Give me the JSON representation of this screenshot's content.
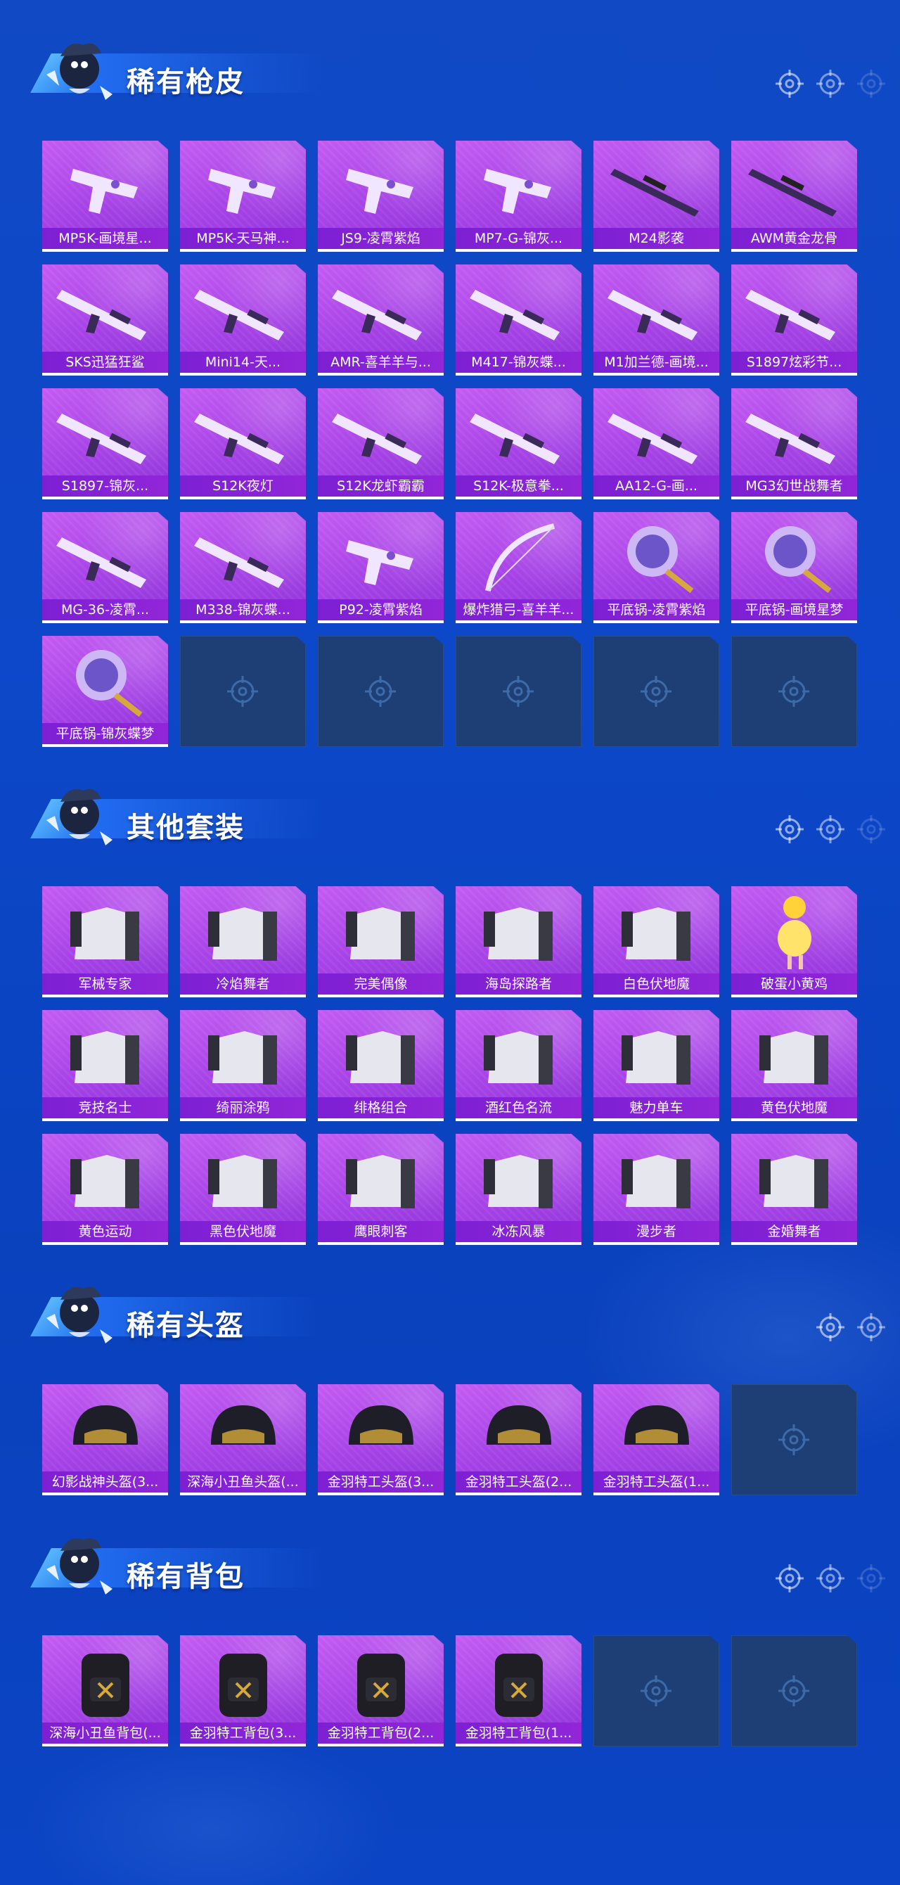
{
  "sections": [
    {
      "title": "稀有枪皮",
      "items": [
        {
          "label": "MP5K-画境星...",
          "icon": "smg-skin-icon"
        },
        {
          "label": "MP5K-天马神...",
          "icon": "smg-skin-icon"
        },
        {
          "label": "JS9-凌霄紫焰",
          "icon": "smg-skin-icon"
        },
        {
          "label": "MP7-G-锦灰...",
          "icon": "smg-skin-icon"
        },
        {
          "label": "M24影袭",
          "icon": "sniper-rifle-icon"
        },
        {
          "label": "AWM黄金龙骨",
          "icon": "sniper-rifle-icon"
        },
        {
          "label": "SKS迅猛狂鲨",
          "icon": "rifle-skin-icon"
        },
        {
          "label": "Mini14-天...",
          "icon": "rifle-skin-icon"
        },
        {
          "label": "AMR-喜羊羊与...",
          "icon": "rifle-skin-icon"
        },
        {
          "label": "M417-锦灰蝶...",
          "icon": "rifle-skin-icon"
        },
        {
          "label": "M1加兰德-画境...",
          "icon": "rifle-skin-icon"
        },
        {
          "label": "S1897炫彩节...",
          "icon": "shotgun-skin-icon"
        },
        {
          "label": "S1897-锦灰...",
          "icon": "shotgun-skin-icon"
        },
        {
          "label": "S12K夜灯",
          "icon": "shotgun-skin-icon"
        },
        {
          "label": "S12K龙虾霸霸",
          "icon": "shotgun-skin-icon"
        },
        {
          "label": "S12K-极意拳...",
          "icon": "shotgun-skin-icon"
        },
        {
          "label": "AA12-G-画...",
          "icon": "shotgun-skin-icon"
        },
        {
          "label": "MG3幻世战舞者",
          "icon": "machine-gun-icon"
        },
        {
          "label": "MG-36-凌霄...",
          "icon": "machine-gun-icon"
        },
        {
          "label": "M338-锦灰蝶...",
          "icon": "machine-gun-icon"
        },
        {
          "label": "P92-凌霄紫焰",
          "icon": "pistol-skin-icon"
        },
        {
          "label": "爆炸猎弓-喜羊羊...",
          "icon": "bow-icon"
        },
        {
          "label": "平底锅-凌霄紫焰",
          "icon": "pan-icon"
        },
        {
          "label": "平底锅-画境星梦",
          "icon": "pan-icon"
        },
        {
          "label": "平底锅-锦灰蝶梦",
          "icon": "pan-icon"
        }
      ],
      "empty_slots": 5
    },
    {
      "title": "其他套装",
      "items": [
        {
          "label": "军械专家",
          "icon": "outfit-icon"
        },
        {
          "label": "冷焰舞者",
          "icon": "outfit-icon"
        },
        {
          "label": "完美偶像",
          "icon": "outfit-icon"
        },
        {
          "label": "海岛探路者",
          "icon": "outfit-icon"
        },
        {
          "label": "白色伏地魔",
          "icon": "outfit-icon"
        },
        {
          "label": "破蛋小黄鸡",
          "icon": "chick-costume-icon"
        },
        {
          "label": "竞技名士",
          "icon": "outfit-icon"
        },
        {
          "label": "绮丽涂鸦",
          "icon": "outfit-icon"
        },
        {
          "label": "绯格组合",
          "icon": "outfit-icon"
        },
        {
          "label": "酒红色名流",
          "icon": "outfit-icon"
        },
        {
          "label": "魅力单车",
          "icon": "outfit-icon"
        },
        {
          "label": "黄色伏地魔",
          "icon": "outfit-icon"
        },
        {
          "label": "黄色运动",
          "icon": "outfit-icon"
        },
        {
          "label": "黑色伏地魔",
          "icon": "outfit-icon"
        },
        {
          "label": "鹰眼刺客",
          "icon": "outfit-icon"
        },
        {
          "label": "冰冻风暴",
          "icon": "outfit-icon"
        },
        {
          "label": "漫步者",
          "icon": "outfit-icon"
        },
        {
          "label": "金婚舞者",
          "icon": "outfit-icon"
        }
      ],
      "empty_slots": 0
    },
    {
      "title": "稀有头盔",
      "items": [
        {
          "label": "幻影战神头盔(3...",
          "icon": "helmet-icon"
        },
        {
          "label": "深海小丑鱼头盔(...",
          "icon": "helmet-icon"
        },
        {
          "label": "金羽特工头盔(3...",
          "icon": "helmet-icon"
        },
        {
          "label": "金羽特工头盔(2...",
          "icon": "helmet-icon"
        },
        {
          "label": "金羽特工头盔(1...",
          "icon": "helmet-icon"
        }
      ],
      "empty_slots": 1
    },
    {
      "title": "稀有背包",
      "items": [
        {
          "label": "深海小丑鱼背包(...",
          "icon": "backpack-icon"
        },
        {
          "label": "金羽特工背包(3...",
          "icon": "backpack-icon"
        },
        {
          "label": "金羽特工背包(2...",
          "icon": "backpack-icon"
        },
        {
          "label": "金羽特工背包(1...",
          "icon": "backpack-icon"
        }
      ],
      "empty_slots": 2
    }
  ],
  "colors": {
    "background": "#0c48c9",
    "tile_purple": "#b24de9",
    "label_bar": "#8a23d6",
    "empty_slot": "#1d3f76"
  }
}
